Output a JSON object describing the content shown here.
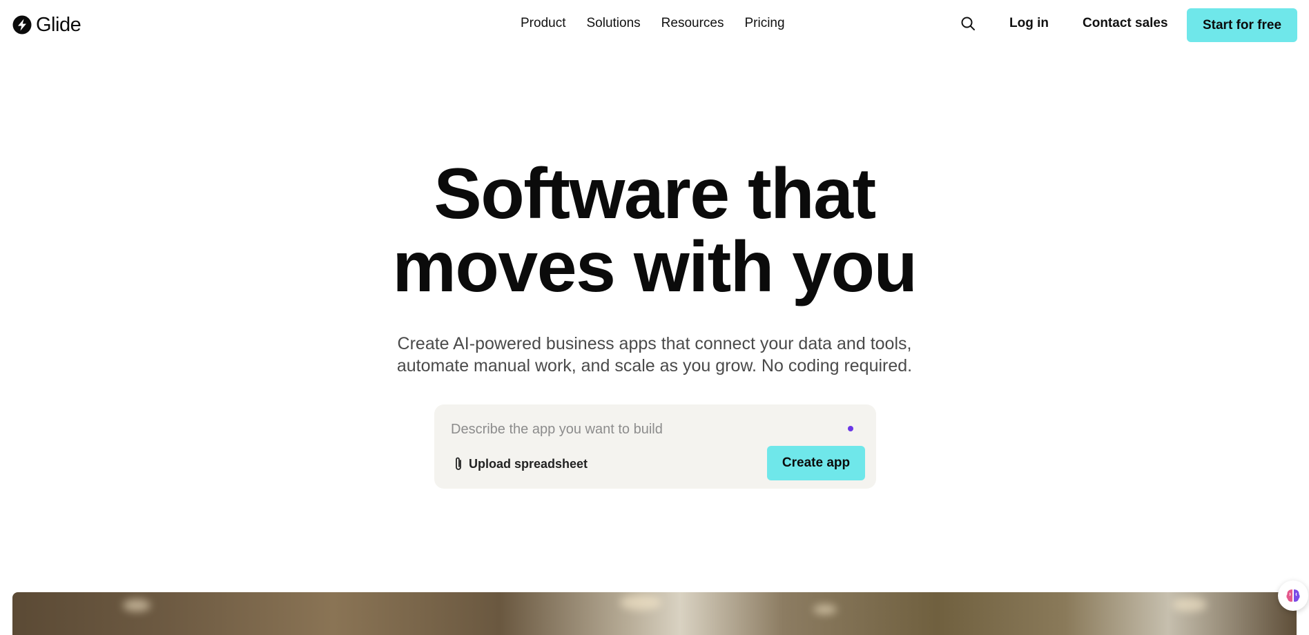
{
  "brand": {
    "name": "Glide",
    "icon": "glide-logo-icon"
  },
  "nav": {
    "items": [
      {
        "label": "Product"
      },
      {
        "label": "Solutions"
      },
      {
        "label": "Resources"
      },
      {
        "label": "Pricing"
      }
    ]
  },
  "header_actions": {
    "search_icon": "search-icon",
    "login_label": "Log in",
    "contact_label": "Contact sales",
    "start_label": "Start for free",
    "accent_color": "#6fe7ea"
  },
  "hero": {
    "title_line1": "Software that",
    "title_line2": "moves with you",
    "subtitle_line1": "Create AI-powered business apps that connect your data and tools,",
    "subtitle_line2": "automate manual work, and scale as you grow. No coding required."
  },
  "prompt": {
    "placeholder": "Describe the app you want to build",
    "value": "",
    "upload_label": "Upload spreadsheet",
    "upload_icon": "paperclip-icon",
    "create_label": "Create app",
    "dot_color": "#6a37e6"
  },
  "chat_widget": {
    "icon": "brain-icon"
  }
}
